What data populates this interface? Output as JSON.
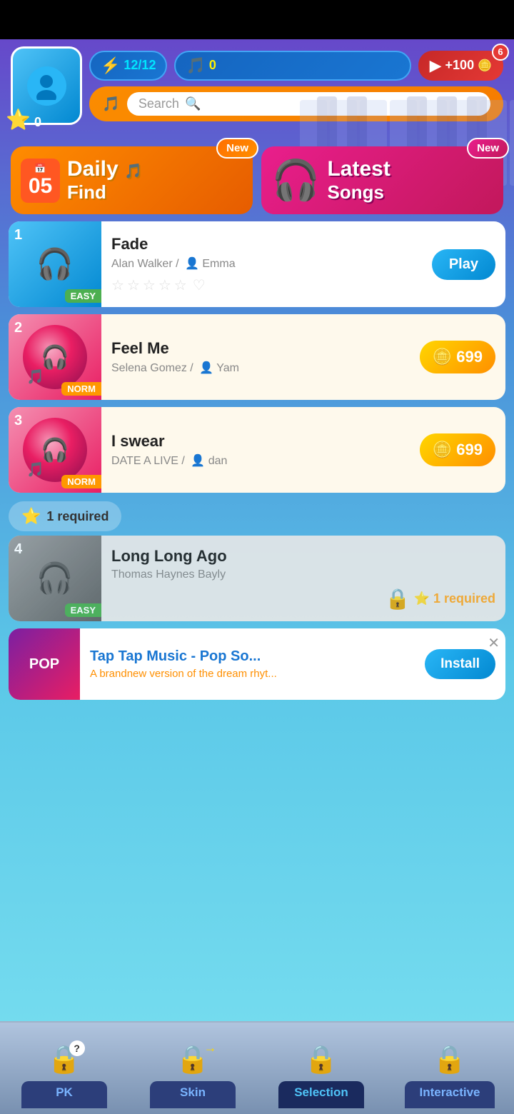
{
  "topBar": {
    "lightning": "12/12",
    "coins": "0",
    "videoBonus": "+100",
    "notificationCount": "6"
  },
  "search": {
    "placeholder": "Search",
    "icon": "search-icon"
  },
  "user": {
    "stars": "0"
  },
  "categories": {
    "dailyFind": {
      "date": "05",
      "title": "Daily",
      "subtitle": "Find",
      "badgeLabel": "New"
    },
    "latestSongs": {
      "title": "Latest",
      "subtitle": "Songs",
      "badgeLabel": "New"
    }
  },
  "songs": [
    {
      "rank": "1",
      "title": "Fade",
      "artist": "Alan Walker /",
      "coverBy": "Emma",
      "difficulty": "EASY",
      "action": "Play",
      "actionType": "play",
      "price": null
    },
    {
      "rank": "2",
      "title": "Feel Me",
      "artist": "Selena Gomez /",
      "coverBy": "Yam",
      "difficulty": "NORM",
      "action": null,
      "actionType": "coin",
      "price": "699"
    },
    {
      "rank": "3",
      "title": "I swear",
      "artist": "DATE A LIVE /",
      "coverBy": "dan",
      "difficulty": "NORM",
      "action": null,
      "actionType": "coin",
      "price": "699"
    }
  ],
  "lockedSection": {
    "requiredLabel": "1 required",
    "song": {
      "rank": "4",
      "title": "Long Long Ago",
      "artist": "Thomas Haynes Bayly",
      "difficulty": "EASY",
      "requireText": "1 required"
    }
  },
  "adBanner": {
    "appTitle": "Tap Tap Music - Pop So...",
    "appDesc": "A brandnew version of the dream rhyt...",
    "installLabel": "Install",
    "appLabel": "POP"
  },
  "bottomNav": {
    "items": [
      {
        "label": "PK",
        "active": false
      },
      {
        "label": "Skin",
        "active": false
      },
      {
        "label": "Selection",
        "active": true
      },
      {
        "label": "Interactive",
        "active": false
      }
    ]
  }
}
